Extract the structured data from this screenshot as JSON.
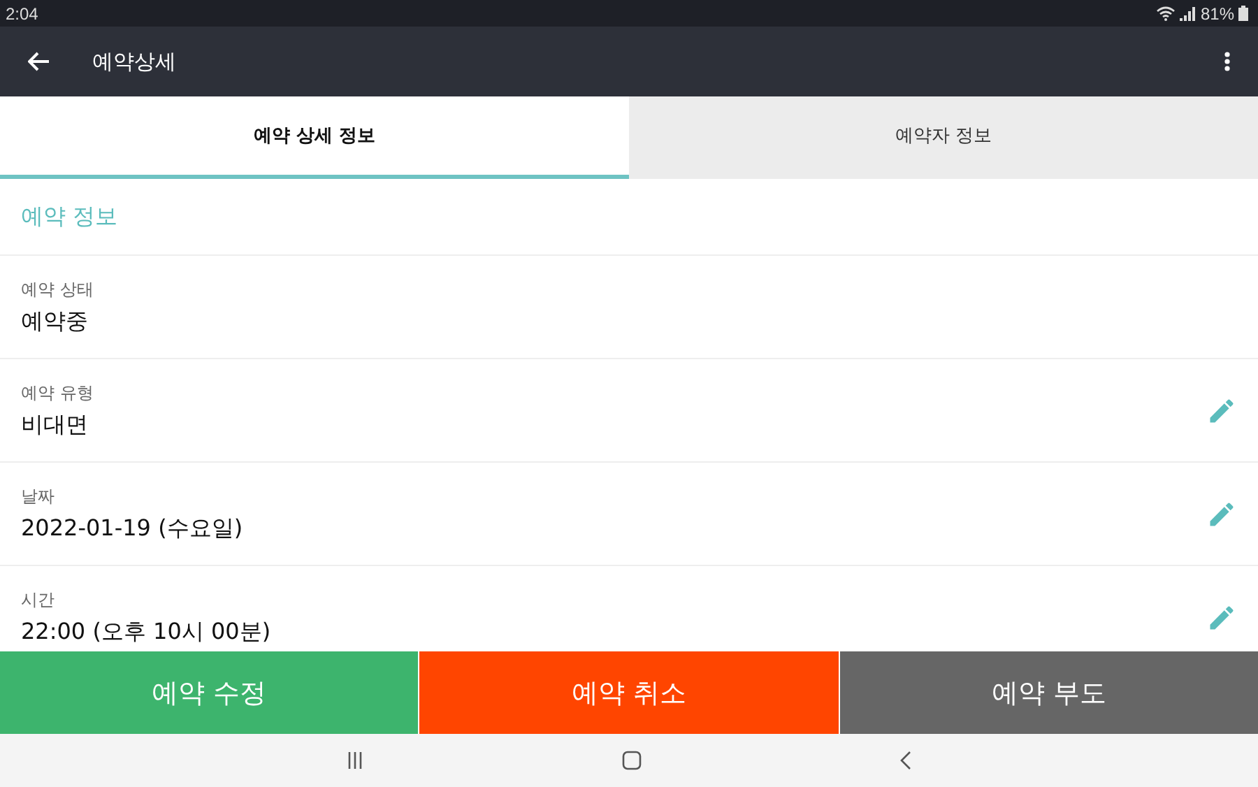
{
  "status_bar": {
    "time": "2:04",
    "battery": "81%"
  },
  "app_bar": {
    "title": "예약상세"
  },
  "tabs": [
    {
      "label": "예약 상세 정보",
      "selected": true
    },
    {
      "label": "예약자 정보",
      "selected": false
    }
  ],
  "section": {
    "title": "예약 정보"
  },
  "fields": [
    {
      "label": "예약 상태",
      "value": "예약중",
      "editable": false
    },
    {
      "label": "예약 유형",
      "value": "비대면",
      "editable": true
    },
    {
      "label": "날짜",
      "value": "2022-01-19 (수요일)",
      "editable": true
    },
    {
      "label": "시간",
      "value": "22:00 (오후 10시 00분)",
      "editable": true
    }
  ],
  "actions": [
    {
      "label": "예약 수정",
      "color": "#3db46d"
    },
    {
      "label": "예약 취소",
      "color": "#ff4500"
    },
    {
      "label": "예약 부도",
      "color": "#666666"
    }
  ]
}
